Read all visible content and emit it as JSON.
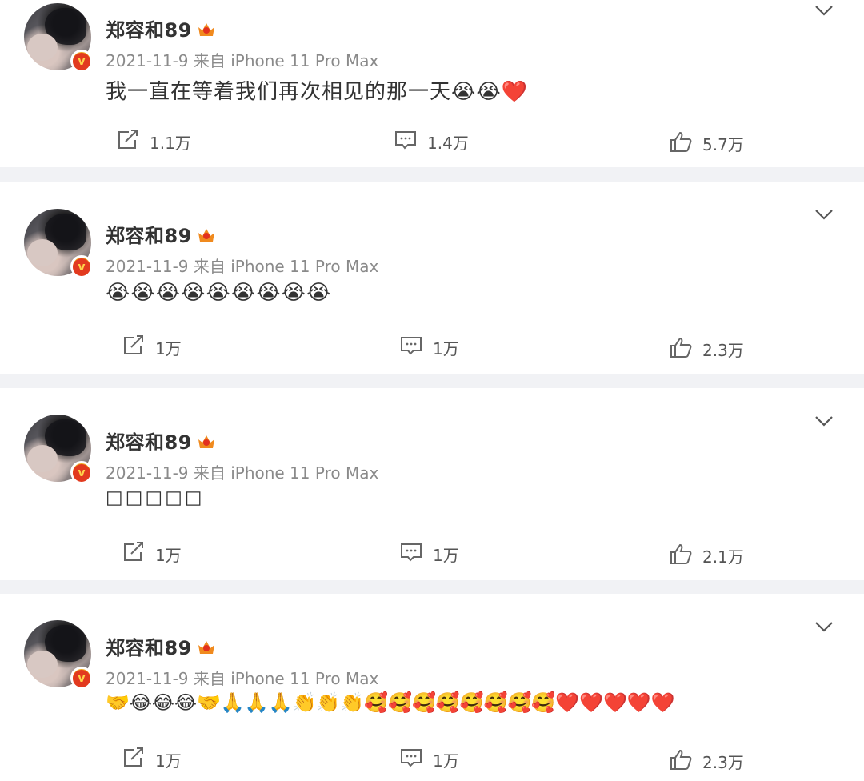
{
  "posts": [
    {
      "username": "郑容和89",
      "meta": "2021-11-9 来自 iPhone 11 Pro Max",
      "content": "我一直在等着我们再次相见的那一天😭😭❤️",
      "repost": "1.1万",
      "comment": "1.4万",
      "like": "5.7万"
    },
    {
      "username": "郑容和89",
      "meta": "2021-11-9 来自 iPhone 11 Pro Max",
      "content": "😭😭😭😭😭😭😭😭😭",
      "repost": "1万",
      "comment": "1万",
      "like": "2.3万"
    },
    {
      "username": "郑容和89",
      "meta": "2021-11-9 来自 iPhone 11 Pro Max",
      "content": "□□□□□",
      "repost": "1万",
      "comment": "1万",
      "like": "2.1万"
    },
    {
      "username": "郑容和89",
      "meta": "2021-11-9 来自 iPhone 11 Pro Max",
      "content": "🤝😂😂😂🤝🙏🙏🙏👏👏👏🥰🥰🥰🥰🥰🥰🥰🥰❤️❤️❤️❤️❤️",
      "repost": "1万",
      "comment": "1万",
      "like": "2.3万"
    }
  ],
  "icons": {
    "repost": "repost-icon",
    "comment": "comment-icon",
    "like": "thumbs-up-icon",
    "menu": "chevron-down-icon",
    "crown": "crown-icon",
    "verified": "verified-badge-icon"
  },
  "colors": {
    "background": "#f1f2f5",
    "card": "#ffffff",
    "meta_text": "#8a8a8a",
    "verified": "#f0a81e",
    "crown": "#f08a1e"
  }
}
